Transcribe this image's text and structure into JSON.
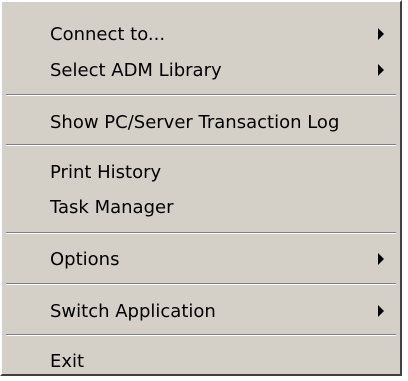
{
  "menu": {
    "items": [
      {
        "label": "Connect to...",
        "has_submenu": true
      },
      {
        "label": "Select ADM Library",
        "has_submenu": true
      },
      {
        "label": "Show PC/Server Transaction Log",
        "has_submenu": false
      },
      {
        "label": "Print History",
        "has_submenu": false
      },
      {
        "label": "Task Manager",
        "has_submenu": false
      },
      {
        "label": "Options",
        "has_submenu": true
      },
      {
        "label": "Switch Application",
        "has_submenu": true
      },
      {
        "label": "Exit",
        "has_submenu": false
      }
    ],
    "submenu_icon": "submenu-arrow-icon",
    "colors": {
      "background": "#d4d0c8",
      "text": "#000000",
      "separator_dark": "#808080",
      "separator_light": "#ffffff"
    }
  }
}
